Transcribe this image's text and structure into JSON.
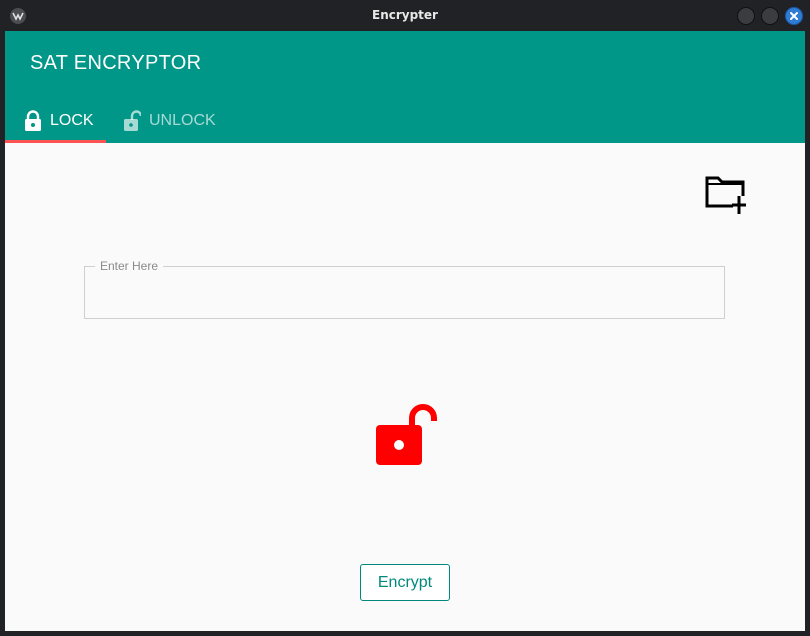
{
  "window": {
    "title": "Encrypter",
    "controls": [
      "minimize-icon",
      "maximize-icon",
      "close-icon"
    ],
    "close_color": "#2f7cd4"
  },
  "app": {
    "title": "SAT ENCRYPTOR",
    "primary_color": "#009688",
    "indicator_color": "#ff5252"
  },
  "tabs": [
    {
      "label": "LOCK",
      "icon": "lock-icon",
      "selected": true
    },
    {
      "label": "UNLOCK",
      "icon": "unlock-icon",
      "selected": false
    }
  ],
  "toolbar": {
    "folder_icon": "create-new-folder-icon"
  },
  "input": {
    "label": "Enter Here",
    "value": ""
  },
  "status": {
    "icon": "unlocked-padlock-icon",
    "color": "#ff0000"
  },
  "actions": {
    "encrypt_label": "Encrypt"
  }
}
